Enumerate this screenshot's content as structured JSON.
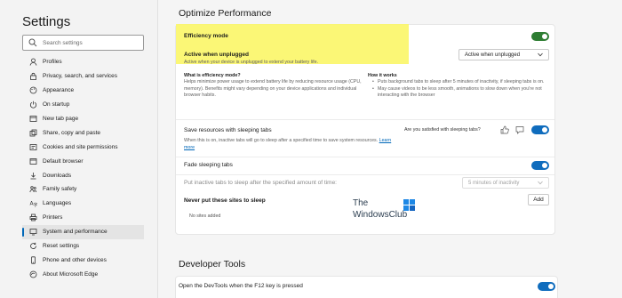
{
  "sidebar": {
    "title": "Settings",
    "search_placeholder": "Search settings",
    "items": [
      {
        "label": "Profiles",
        "icon": "profile-icon"
      },
      {
        "label": "Privacy, search, and services",
        "icon": "lock-icon"
      },
      {
        "label": "Appearance",
        "icon": "appearance-icon"
      },
      {
        "label": "On startup",
        "icon": "power-icon"
      },
      {
        "label": "New tab page",
        "icon": "new-tab-icon"
      },
      {
        "label": "Share, copy and paste",
        "icon": "share-icon"
      },
      {
        "label": "Cookies and site permissions",
        "icon": "cookies-icon"
      },
      {
        "label": "Default browser",
        "icon": "browser-icon"
      },
      {
        "label": "Downloads",
        "icon": "download-icon"
      },
      {
        "label": "Family safety",
        "icon": "family-icon"
      },
      {
        "label": "Languages",
        "icon": "languages-icon"
      },
      {
        "label": "Printers",
        "icon": "printer-icon"
      },
      {
        "label": "System and performance",
        "icon": "system-icon",
        "active": true
      },
      {
        "label": "Reset settings",
        "icon": "reset-icon"
      },
      {
        "label": "Phone and other devices",
        "icon": "phone-icon"
      },
      {
        "label": "About Microsoft Edge",
        "icon": "edge-icon"
      }
    ]
  },
  "main": {
    "section_title": "Optimize Performance",
    "efficiency_mode": {
      "label": "Efficiency mode",
      "toggle_on": true,
      "sub_label": "Active when unplugged",
      "sub_desc": "Active when your device is unplugged to extend your battery life.",
      "dropdown_value": "Active when unplugged",
      "what_title": "What is efficiency mode?",
      "what_desc": "Helps minimize power usage to extend battery life by reducing resource usage (CPU, memory). Benefits might vary depending on your device applications and individual browser habits.",
      "how_title": "How it works",
      "how_points": [
        "Puts background tabs to sleep after 5 minutes of inactivity, if sleeping tabs is on.",
        "May cause videos to be less smooth, animations to slow down when you're not interacting with the browser"
      ]
    },
    "sleeping_tabs": {
      "label": "Save resources with sleeping tabs",
      "desc": "When this is on, inactive tabs will go to sleep after a specified time to save system resources.",
      "learn_more": "Learn more",
      "feedback_prompt": "Are you satisfied with sleeping tabs?",
      "toggle_on": true
    },
    "fade_tabs": {
      "label": "Fade sleeping tabs",
      "toggle_on": true
    },
    "inactive_after": {
      "label": "Put inactive tabs to sleep after the specified amount of time:",
      "dropdown_value": "5 minutes of inactivity"
    },
    "never_sleep": {
      "label": "Never put these sites to sleep",
      "add_button": "Add",
      "empty_text": "No sites added"
    },
    "developer_tools": {
      "section_title": "Developer Tools",
      "devtools_label": "Open the DevTools when the F12 key is pressed",
      "toggle_on": true
    }
  },
  "watermark": {
    "line1": "The",
    "line2": "WindowsClub"
  },
  "colors": {
    "accent": "#0f6cbd",
    "efficiency_toggle": "#2e7d32",
    "highlight": "#fbf66a"
  }
}
